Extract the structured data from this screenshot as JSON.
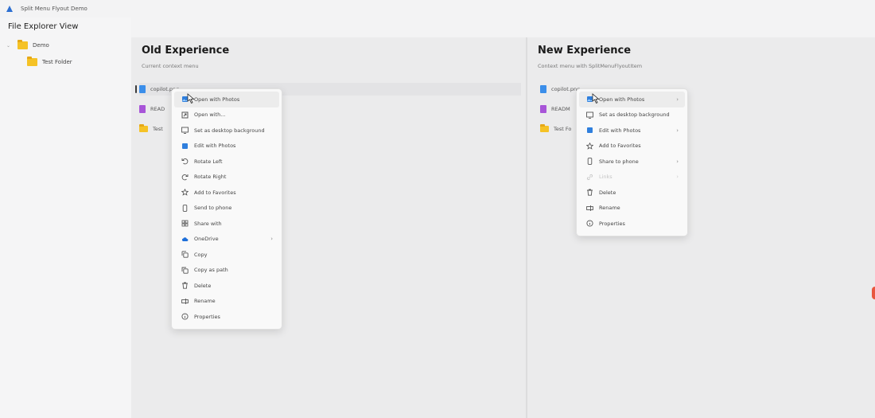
{
  "window": {
    "title": "Split Menu Flyout Demo"
  },
  "sidebar": {
    "title": "File Explorer View",
    "tree": [
      {
        "label": "Demo",
        "expanded": true
      },
      {
        "label": "Test Folder"
      }
    ]
  },
  "old_panel": {
    "title": "Old Experience",
    "subtitle": "Current context menu",
    "files": [
      {
        "name": "copilot.png",
        "type": "image"
      },
      {
        "name": "READ",
        "type": "markdown"
      },
      {
        "name": "Test",
        "type": "folder"
      }
    ],
    "menu": [
      {
        "label": "Open with Photos",
        "icon": "photos-icon"
      },
      {
        "label": "Open with...",
        "icon": "open-with-icon"
      },
      {
        "label": "Set as desktop background",
        "icon": "desktop-background-icon"
      },
      {
        "label": "Edit with Photos",
        "icon": "photos-edit-icon"
      },
      {
        "label": "Rotate Left",
        "icon": "rotate-left-icon"
      },
      {
        "label": "Rotate Right",
        "icon": "rotate-right-icon"
      },
      {
        "label": "Add to Favorites",
        "icon": "star-icon"
      },
      {
        "label": "Send to phone",
        "icon": "phone-icon"
      },
      {
        "label": "Share with",
        "icon": "share-icon"
      },
      {
        "label": "OneDrive",
        "icon": "cloud-icon",
        "submenu": true
      },
      {
        "label": "Copy",
        "icon": "copy-icon"
      },
      {
        "label": "Copy as path",
        "icon": "copy-path-icon"
      },
      {
        "label": "Delete",
        "icon": "trash-icon"
      },
      {
        "label": "Rename",
        "icon": "rename-icon"
      },
      {
        "label": "Properties",
        "icon": "properties-icon"
      }
    ]
  },
  "new_panel": {
    "title": "New Experience",
    "subtitle": "Context menu with SplitMenuFlyoutItem",
    "files": [
      {
        "name": "copilot.png",
        "type": "image"
      },
      {
        "name": "READM",
        "type": "markdown"
      },
      {
        "name": "Test Fo",
        "type": "folder"
      }
    ],
    "menu": [
      {
        "label": "Open with Photos",
        "icon": "photos-icon",
        "submenu": true
      },
      {
        "label": "Set as desktop background",
        "icon": "desktop-background-icon"
      },
      {
        "label": "Edit with Photos",
        "icon": "photos-edit-icon",
        "submenu": true
      },
      {
        "label": "Add to Favorites",
        "icon": "star-icon"
      },
      {
        "label": "Share to phone",
        "icon": "phone-icon",
        "submenu": true
      },
      {
        "label": "Links",
        "icon": "link-icon",
        "submenu": true,
        "disabled": true
      },
      {
        "label": "Delete",
        "icon": "trash-icon"
      },
      {
        "label": "Rename",
        "icon": "rename-icon"
      },
      {
        "label": "Properties",
        "icon": "properties-icon"
      }
    ]
  },
  "colors": {
    "accent": "#3b8eea",
    "folder": "#f5c226",
    "markdown": "#a855d8",
    "edge_indicator": "#e8573f"
  }
}
